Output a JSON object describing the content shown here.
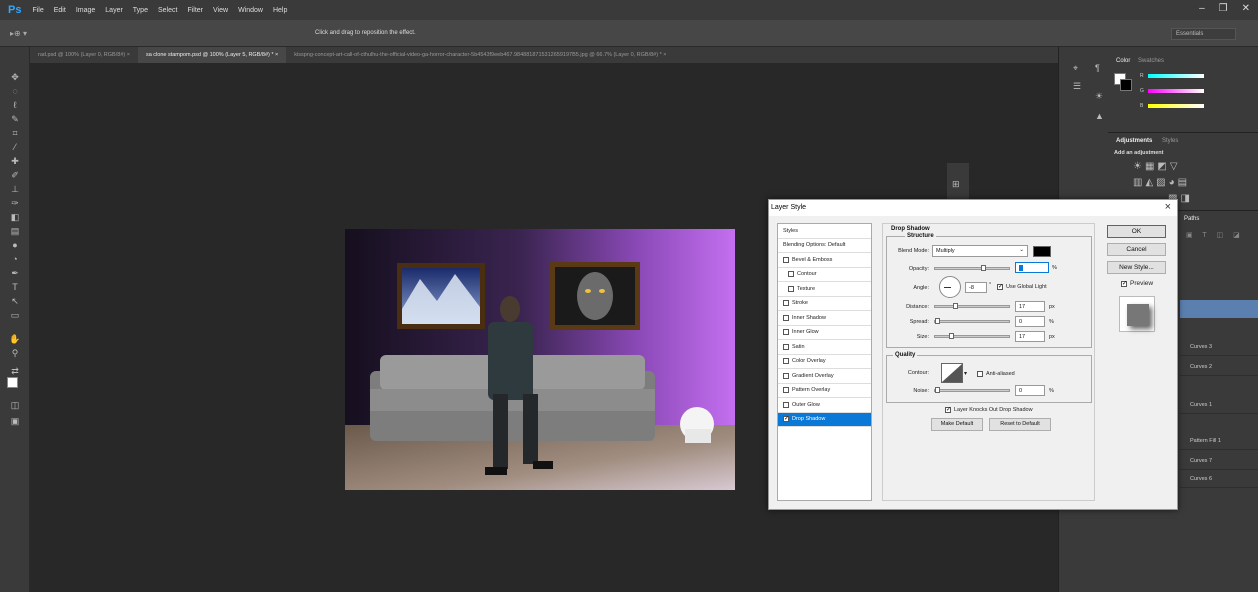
{
  "app": {
    "logo": "Ps"
  },
  "menubar": {
    "items": [
      "File",
      "Edit",
      "Image",
      "Layer",
      "Type",
      "Select",
      "Filter",
      "View",
      "Window",
      "Help"
    ]
  },
  "options": {
    "hint": "Click and drag to reposition the effect.",
    "workspace": "Essentials"
  },
  "tabs": [
    {
      "label": "rad.psd @ 100% (Layer 0, RGB/8#) ×",
      "active": false
    },
    {
      "label": "sa clone stampom.psd @ 100% (Layer 5, RGB/8#) * ×",
      "active": true
    },
    {
      "label": "kisspng-concept-art-call-of-cthulhu-the-official-video-ga-horror-character-5b4543f9eeb467.9848818715312659197B5.jpg @ 66.7% (Layer 0, RGB/8#) * ×",
      "active": false
    }
  ],
  "panels": {
    "color_tabs": [
      "Color",
      "Swatches"
    ],
    "adjustments_tabs": [
      "Adjustments",
      "Styles"
    ],
    "adjustments_label": "Add an adjustment",
    "layers_tab": "Paths",
    "layers": [
      "Curves 3",
      "Curves 2",
      "Curves 1",
      "Pattern Fill 1",
      "Curves 7",
      "Curves 6"
    ],
    "color_channels": [
      "R",
      "G",
      "B"
    ]
  },
  "dialog": {
    "title": "Layer Style",
    "close": "×",
    "styles_list": [
      {
        "label": "Styles",
        "check": false,
        "indent": false,
        "selected": false
      },
      {
        "label": "Blending Options: Default",
        "check": false,
        "indent": false,
        "selected": false
      },
      {
        "label": "Bevel & Emboss",
        "check": true,
        "indent": false,
        "selected": false
      },
      {
        "label": "Contour",
        "check": true,
        "indent": true,
        "selected": false
      },
      {
        "label": "Texture",
        "check": true,
        "indent": true,
        "selected": false
      },
      {
        "label": "Stroke",
        "check": true,
        "indent": false,
        "selected": false
      },
      {
        "label": "Inner Shadow",
        "check": true,
        "indent": false,
        "selected": false
      },
      {
        "label": "Inner Glow",
        "check": true,
        "indent": false,
        "selected": false
      },
      {
        "label": "Satin",
        "check": true,
        "indent": false,
        "selected": false
      },
      {
        "label": "Color Overlay",
        "check": true,
        "indent": false,
        "selected": false
      },
      {
        "label": "Gradient Overlay",
        "check": true,
        "indent": false,
        "selected": false
      },
      {
        "label": "Pattern Overlay",
        "check": true,
        "indent": false,
        "selected": false
      },
      {
        "label": "Outer Glow",
        "check": true,
        "indent": false,
        "selected": false
      },
      {
        "label": "Drop Shadow",
        "check": true,
        "indent": false,
        "selected": true
      }
    ],
    "drop_shadow": {
      "title": "Drop Shadow",
      "structure": "Structure",
      "blend_mode_label": "Blend Mode:",
      "blend_mode": "Multiply",
      "opacity_label": "Opacity:",
      "opacity": "",
      "angle_label": "Angle:",
      "angle": "-8",
      "use_global_light": "Use Global Light",
      "distance_label": "Distance:",
      "distance": "17",
      "spread_label": "Spread:",
      "spread": "0",
      "size_label": "Size:",
      "size": "17",
      "px": "px",
      "pct": "%",
      "deg": "°",
      "quality": "Quality",
      "contour_label": "Contour:",
      "anti_aliased": "Anti-aliased",
      "noise_label": "Noise:",
      "noise": "0",
      "knocks_out": "Layer Knocks Out Drop Shadow",
      "make_default": "Make Default",
      "reset_default": "Reset to Default"
    },
    "buttons": {
      "ok": "OK",
      "cancel": "Cancel",
      "new_style": "New Style...",
      "preview": "Preview"
    }
  },
  "colors": {
    "accent": "#0a78d7",
    "wall_purple": "#b45ee0",
    "ps_blue": "#31a8ff"
  }
}
